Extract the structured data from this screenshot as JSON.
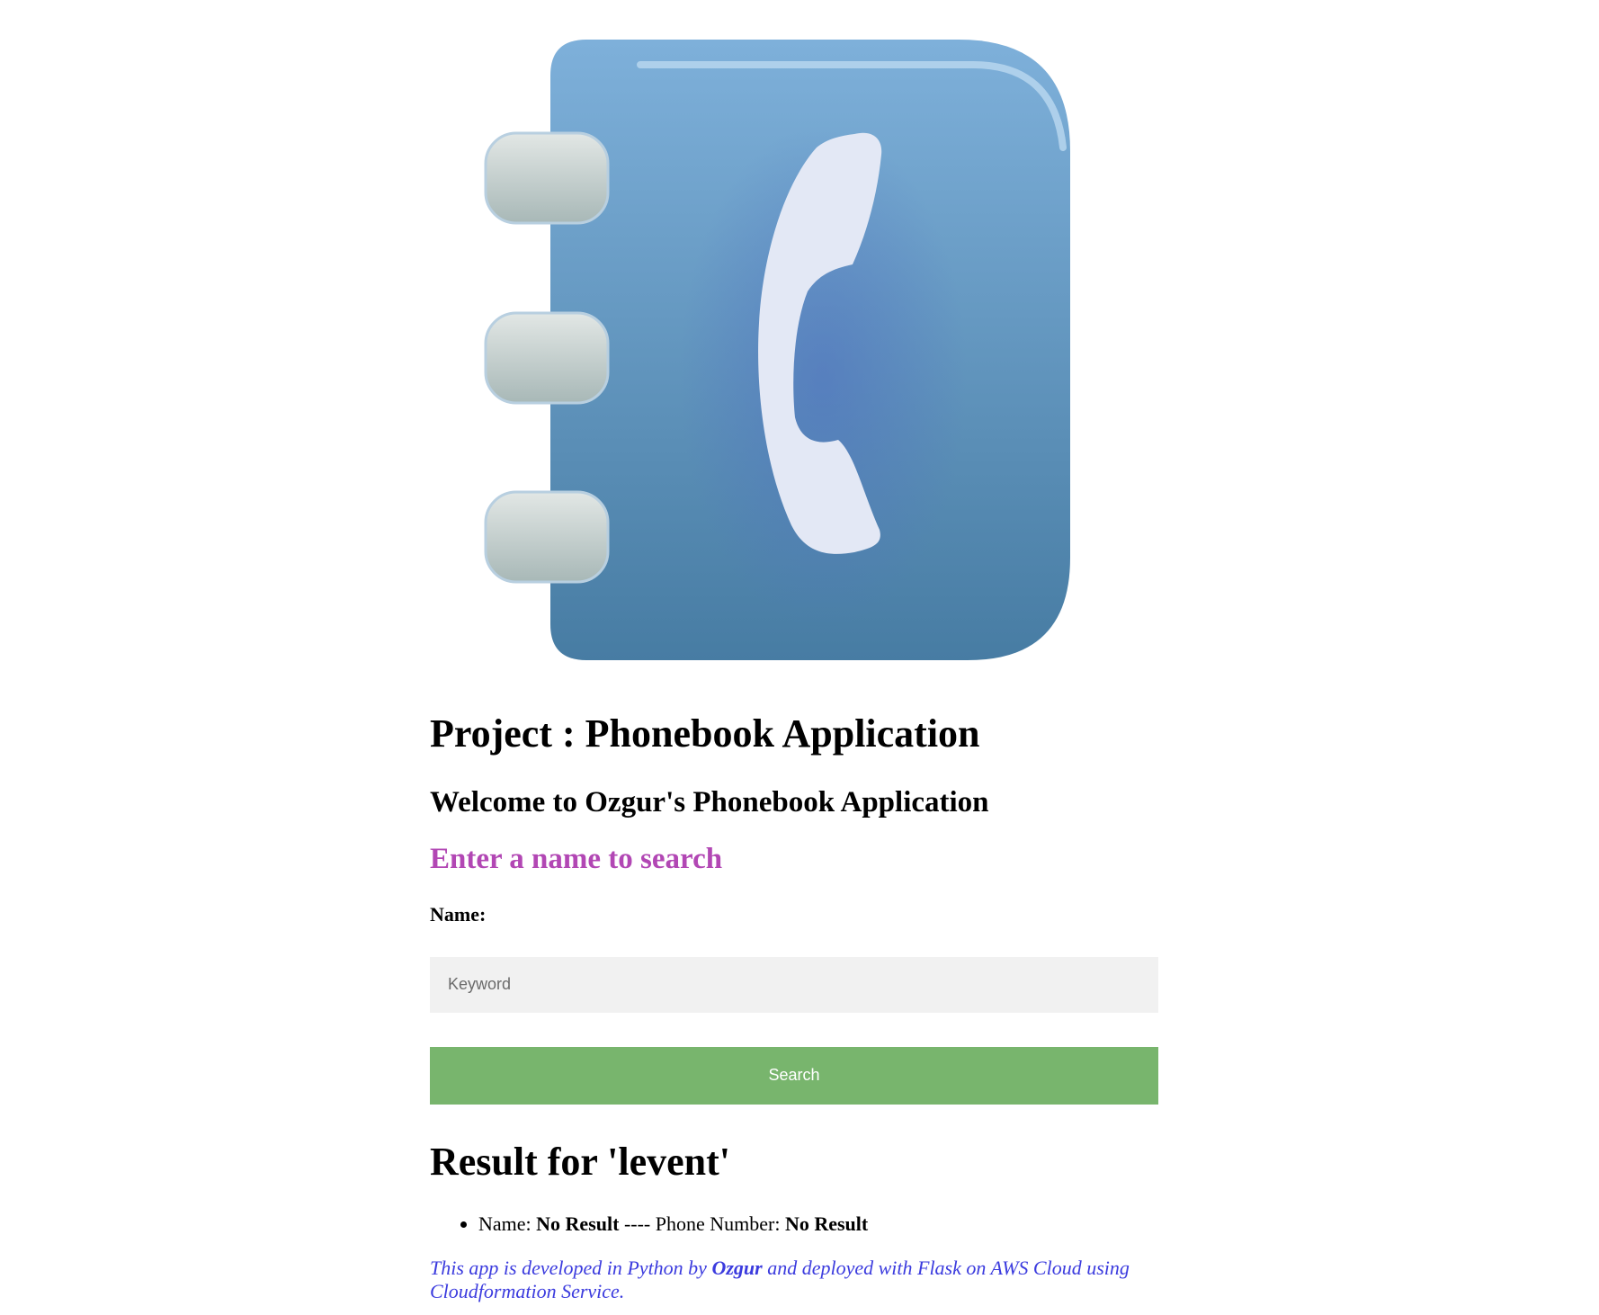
{
  "logo": {
    "icon": "phonebook-icon",
    "colors": {
      "cover_top": "#7eb0da",
      "cover_bottom": "#477ca3",
      "rings": "#c7d1d0",
      "tabs": "#f7c63e",
      "handset": "#e3e8f5"
    }
  },
  "header": {
    "title": "Project : Phonebook Application",
    "welcome": "Welcome to Ozgur's Phonebook Application",
    "prompt": "Enter a name to search"
  },
  "form": {
    "name_label": "Name:",
    "keyword_placeholder": "Keyword",
    "keyword_value": "",
    "search_label": "Search"
  },
  "results": {
    "title": "Result for 'levent'",
    "items": [
      {
        "name_prefix": "Name: ",
        "name_value": "No Result",
        "separator": " ---- Phone Number: ",
        "phone_value": "No Result"
      }
    ]
  },
  "footer": {
    "before": "This app is developed in Python by ",
    "author": "Ozgur",
    "after": " and deployed with Flask on AWS Cloud using Cloudformation Service."
  },
  "colors": {
    "prompt": "#b247b4",
    "search_button": "#78b56d",
    "footer_text": "#3b3bde",
    "input_bg": "#f1f1f1"
  }
}
